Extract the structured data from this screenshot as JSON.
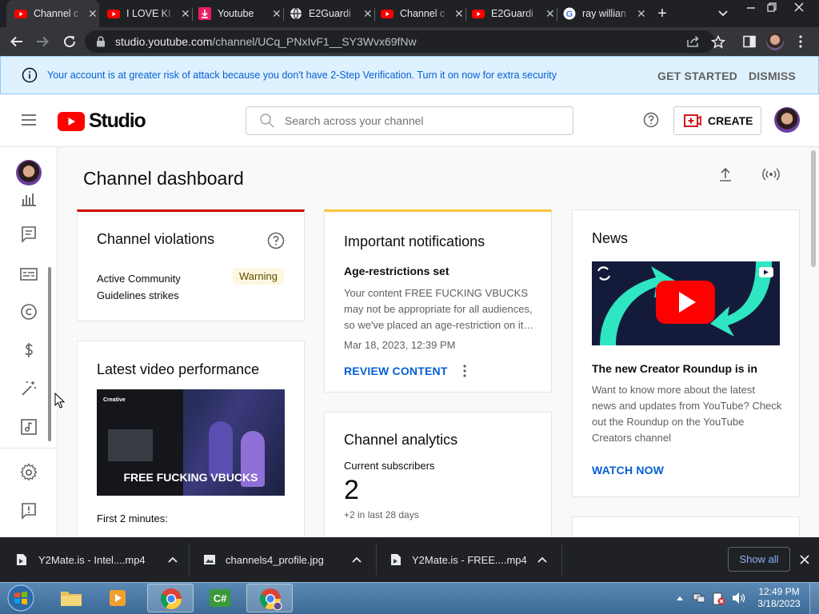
{
  "browser": {
    "tabs": [
      {
        "title": "Channel c",
        "icon": "youtube-favicon",
        "active": true
      },
      {
        "title": "I LOVE KI",
        "icon": "youtube-favicon",
        "active": false
      },
      {
        "title": "Youtube",
        "icon": "download-favicon",
        "active": false
      },
      {
        "title": "E2Guardi",
        "icon": "globe-favicon",
        "active": false
      },
      {
        "title": "Channel c",
        "icon": "youtube-favicon",
        "active": false
      },
      {
        "title": "E2Guardi",
        "icon": "youtube-favicon",
        "active": false
      },
      {
        "title": "ray willian",
        "icon": "google-favicon",
        "active": false
      }
    ],
    "url_host": "studio.youtube.com",
    "url_path": "/channel/UCq_PNxIvF1__SY3Wvx69fNw"
  },
  "banner": {
    "message": "Your account is at greater risk of attack because you don't have 2-Step Verification. Turn it on now for extra security",
    "get_started": "GET STARTED",
    "dismiss": "DISMISS"
  },
  "header": {
    "logo_text": "Studio",
    "search_placeholder": "Search across your channel",
    "create_label": "CREATE"
  },
  "dashboard": {
    "title": "Channel dashboard",
    "violations": {
      "title": "Channel violations",
      "label_line1": "Active Community",
      "label_line2": "Guidelines strikes",
      "status": "Warning"
    },
    "latest_video": {
      "title": "Latest video performance",
      "thumbnail_caption": "FREE FUCKING VBUCKS",
      "thumbnail_overlay_title": "Creative",
      "footer": "First 2 minutes:"
    },
    "notifications": {
      "title": "Important notifications",
      "subtitle": "Age-restrictions set",
      "body_line1": "Your content FREE FUCKING VBUCKS",
      "body_line2": "may not be appropriate for all audiences,",
      "body_line3": "so we've placed an age-restriction on it…",
      "date": "Mar 18, 2023, 12:39 PM",
      "action": "REVIEW CONTENT"
    },
    "analytics": {
      "title": "Channel analytics",
      "subscribers_label": "Current subscribers",
      "subscribers": "2",
      "change": "+2 in last 28 days"
    },
    "news": {
      "title": "News",
      "headline": "The new Creator Roundup is in",
      "body_line1": "Want to know more about the latest",
      "body_line2": "news and updates from YouTube? Check",
      "body_line3": "out the Roundup on the YouTube",
      "body_line4": "Creators channel",
      "action": "WATCH NOW"
    }
  },
  "downloads": {
    "items": [
      {
        "name": "Y2Mate.is - Intel....mp4",
        "icon": "video-file-icon"
      },
      {
        "name": "channels4_profile.jpg",
        "icon": "image-file-icon"
      },
      {
        "name": "Y2Mate.is - FREE....mp4",
        "icon": "video-file-icon"
      }
    ],
    "show_all": "Show all"
  },
  "taskbar": {
    "time": "12:49 PM",
    "date": "3/18/2023"
  },
  "colors": {
    "youtube_red": "#ff0000",
    "link_blue": "#065fd4",
    "violations_accent": "#cc0000",
    "notifications_accent": "#f9c13d",
    "banner_bg": "#def1ff"
  }
}
